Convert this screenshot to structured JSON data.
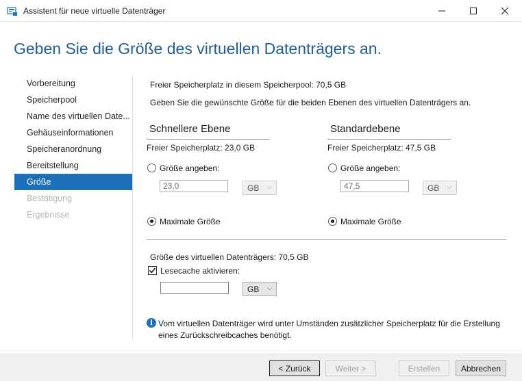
{
  "window": {
    "title": "Assistent für neue virtuelle Datenträger",
    "minimize_glyph": "—",
    "maximize_glyph": "☐",
    "close_glyph": "✕"
  },
  "page": {
    "title": "Geben Sie die Größe des virtuellen Datenträgers an."
  },
  "nav": {
    "items": [
      {
        "label": "Vorbereitung",
        "state": "normal"
      },
      {
        "label": "Speicherpool",
        "state": "normal"
      },
      {
        "label": "Name des virtuellen Date...",
        "state": "normal"
      },
      {
        "label": "Gehäuseinformationen",
        "state": "normal"
      },
      {
        "label": "Speicheranordnung",
        "state": "normal"
      },
      {
        "label": "Bereitstellung",
        "state": "normal"
      },
      {
        "label": "Größe",
        "state": "active"
      },
      {
        "label": "Bestätigung",
        "state": "disabled"
      },
      {
        "label": "Ergebnisse",
        "state": "disabled"
      }
    ]
  },
  "main": {
    "pool_free": "Freier Speicherplatz in diesem Speicherpool: 70,5 GB",
    "instruction": "Geben Sie die gewünschte Größe für die beiden Ebenen des virtuellen Datenträgers an.",
    "fast_tier": {
      "heading": "Schnellere Ebene",
      "free": "Freier Speicherplatz: 23,0 GB",
      "specify_label": "Größe angeben:",
      "size_value": "23,0",
      "unit": "GB",
      "max_label": "Maximale Größe",
      "selected": "max"
    },
    "standard_tier": {
      "heading": "Standardebene",
      "free": "Freier Speicherplatz: 47,5 GB",
      "specify_label": "Größe angeben:",
      "size_value": "47,5",
      "unit": "GB",
      "max_label": "Maximale Größe",
      "selected": "max"
    },
    "total_size": "Größe des virtuellen Datenträgers: 70,5 GB",
    "read_cache": {
      "label": "Lesecache aktivieren:",
      "checked": true,
      "value": "",
      "unit": "GB"
    },
    "info_text_line1": "Vom virtuellen Datenträger wird unter Umständen zusätzlicher Speicherplatz für die Erstellung",
    "info_text_line2": "eines Zurückschreibcaches benötigt."
  },
  "footer": {
    "back": "< Zurück",
    "next": "Weiter >",
    "create": "Erstellen",
    "cancel": "Abbrechen"
  },
  "colors": {
    "accent": "#1d6fb8",
    "title_blue": "#1f5c99"
  }
}
